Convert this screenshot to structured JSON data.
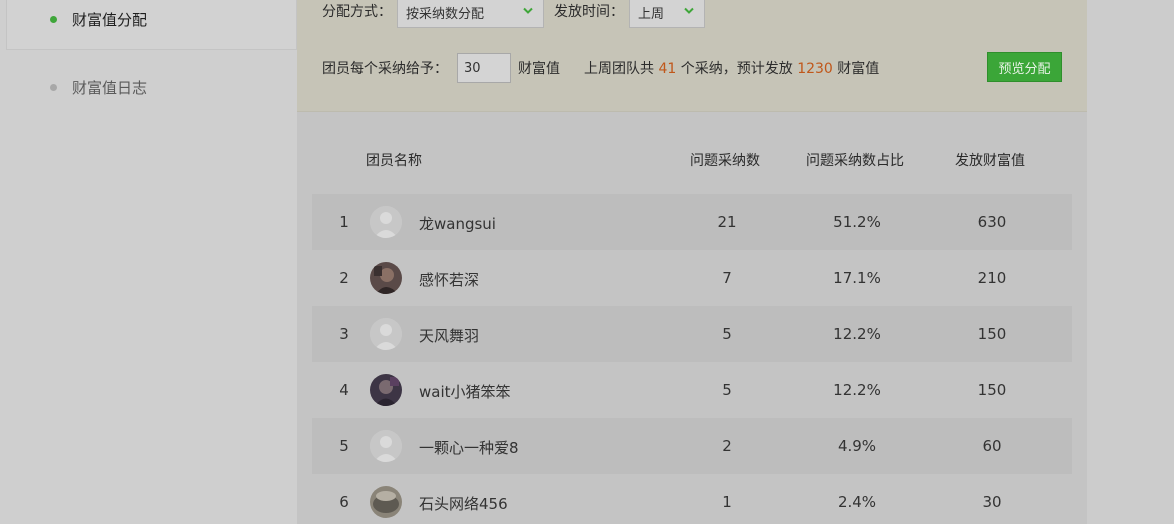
{
  "sidebar": {
    "items": [
      {
        "label": "财富值分配"
      },
      {
        "label": "财富值日志"
      }
    ]
  },
  "config": {
    "mode_label": "分配方式：",
    "mode_value": "按采纳数分配",
    "time_label": "发放时间：",
    "time_value": "上周",
    "per_label": "团员每个采纳给予：",
    "per_value": "30",
    "per_unit": "财富值",
    "summary_prefix": "上周团队共",
    "summary_count": "41",
    "summary_mid": "个采纳，预计发放",
    "summary_total": "1230",
    "summary_suffix": "财富值",
    "preview_button": "预览分配"
  },
  "table": {
    "headers": {
      "name": "团员名称",
      "count": "问题采纳数",
      "ratio": "问题采纳数占比",
      "value": "发放财富值"
    },
    "rows": [
      {
        "idx": "1",
        "name": "龙wangsui",
        "count": "21",
        "ratio": "51.2%",
        "value": "630",
        "avatar": "default-avatar-icon"
      },
      {
        "idx": "2",
        "name": "感怀若深",
        "count": "7",
        "ratio": "17.1%",
        "value": "210",
        "avatar": "photo-avatar"
      },
      {
        "idx": "3",
        "name": "天风舞羽",
        "count": "5",
        "ratio": "12.2%",
        "value": "150",
        "avatar": "default-avatar-icon"
      },
      {
        "idx": "4",
        "name": "wait小猪笨笨",
        "count": "5",
        "ratio": "12.2%",
        "value": "150",
        "avatar": "photo-avatar"
      },
      {
        "idx": "5",
        "name": "一颗心一种爱8",
        "count": "2",
        "ratio": "4.9%",
        "value": "60",
        "avatar": "default-avatar-icon"
      },
      {
        "idx": "6",
        "name": "石头网络456",
        "count": "1",
        "ratio": "2.4%",
        "value": "30",
        "avatar": "photo-avatar"
      }
    ]
  },
  "colors": {
    "accent_green": "#3fa63a",
    "highlight_orange": "#c0571a",
    "config_bg": "#c6c4b7"
  }
}
